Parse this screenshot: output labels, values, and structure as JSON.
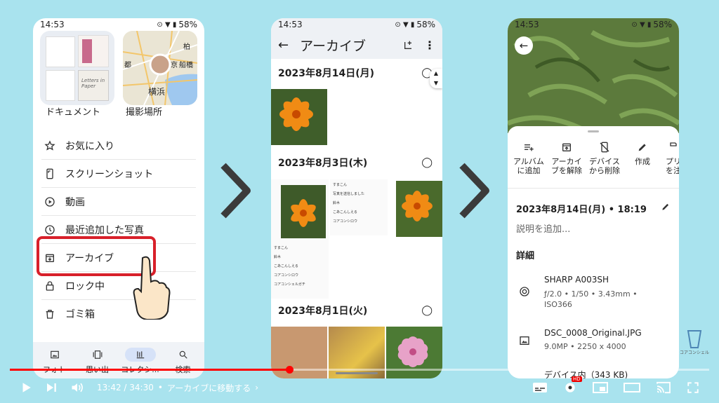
{
  "status": {
    "time": "14:53",
    "battery": "58%"
  },
  "panel1": {
    "grid": [
      {
        "label": "ドキュメント"
      },
      {
        "label": "撮影場所"
      }
    ],
    "map_labels": [
      "柏",
      "都",
      "京",
      "船橋",
      "横浜"
    ],
    "doc_text": "Letters in Paper",
    "menu": [
      {
        "icon": "star-icon",
        "label": "お気に入り"
      },
      {
        "icon": "screenshot-icon",
        "label": "スクリーンショット"
      },
      {
        "icon": "video-icon",
        "label": "動画"
      },
      {
        "icon": "recent-icon",
        "label": "最近追加した写真"
      },
      {
        "icon": "archive-icon",
        "label": "アーカイブ"
      },
      {
        "icon": "lock-icon",
        "label": "ロック中"
      },
      {
        "icon": "trash-icon",
        "label": "ゴミ箱"
      }
    ],
    "nav": [
      {
        "icon": "photo-icon",
        "label": "フォト"
      },
      {
        "icon": "memories-icon",
        "label": "思い出"
      },
      {
        "icon": "collection-icon",
        "label": "コレクシ..."
      },
      {
        "icon": "search-icon",
        "label": "検索"
      }
    ]
  },
  "panel2": {
    "title": "アーカイブ",
    "sections": [
      {
        "date": "2023年8月14日(月)"
      },
      {
        "date": "2023年8月3日(木)"
      },
      {
        "date": "2023年8月1日(火)"
      }
    ],
    "chat_names": [
      "すまこん",
      "写真を送信しました",
      "鈴木",
      "こあこんしえる",
      "コアコンシロウ",
      "コアコンシェルガチ"
    ]
  },
  "panel3": {
    "actions": [
      {
        "icon": "album-add-icon",
        "label": "アルバム\nに追加"
      },
      {
        "icon": "unarchive-icon",
        "label": "アーカイ\nブを解除"
      },
      {
        "icon": "device-delete-icon",
        "label": "デバイス\nから削除"
      },
      {
        "icon": "edit-icon",
        "label": "作成"
      },
      {
        "icon": "print-icon",
        "label": "プリ\nを注"
      }
    ],
    "datetime": "2023年8月14日(月) • 18:19",
    "description_placeholder": "説明を追加...",
    "details_header": "詳細",
    "camera": {
      "model": "SHARP A003SH",
      "specs": "ƒ/2.0 • 1/50 • 3.43mm •\nISO366"
    },
    "file": {
      "name": "DSC_0008_Original.JPG",
      "specs": "9.0MP • 2250 x 4000"
    },
    "storage": "デバイス内（343 KB)"
  },
  "watermark": "コアコンシェル",
  "player": {
    "time": "13:42 / 34:30",
    "chapter": "アーカイブに移動する",
    "progress": 0.3998,
    "hd_badge": "HD"
  }
}
